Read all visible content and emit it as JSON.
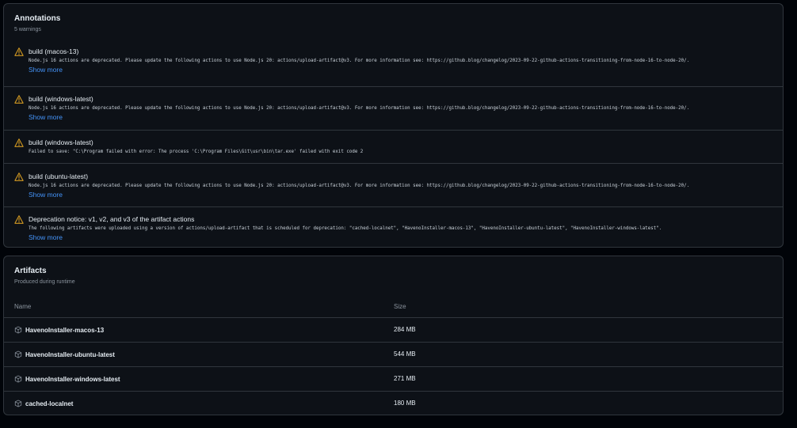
{
  "annotations": {
    "title": "Annotations",
    "subtitle": "5 warnings",
    "items": [
      {
        "title": "build (macos-13)",
        "message": "Node.js 16 actions are deprecated. Please update the following actions to use Node.js 20: actions/upload-artifact@v3. For more information see: https://github.blog/changelog/2023-09-22-github-actions-transitioning-from-node-16-to-node-20/.",
        "more": "Show more"
      },
      {
        "title": "build (windows-latest)",
        "message": "Node.js 16 actions are deprecated. Please update the following actions to use Node.js 20: actions/upload-artifact@v3. For more information see: https://github.blog/changelog/2023-09-22-github-actions-transitioning-from-node-16-to-node-20/.",
        "more": "Show more"
      },
      {
        "title": "build (windows-latest)",
        "message": "Failed to save: \"C:\\Program failed with error: The process 'C:\\Program Files\\Git\\usr\\bin\\tar.exe' failed with exit code 2",
        "more": ""
      },
      {
        "title": "build (ubuntu-latest)",
        "message": "Node.js 16 actions are deprecated. Please update the following actions to use Node.js 20: actions/upload-artifact@v3. For more information see: https://github.blog/changelog/2023-09-22-github-actions-transitioning-from-node-16-to-node-20/.",
        "more": "Show more"
      },
      {
        "title": "Deprecation notice: v1, v2, and v3 of the artifact actions",
        "message": "The following artifacts were uploaded using a version of actions/upload-artifact that is scheduled for deprecation: \"cached-localnet\", \"HavenoInstaller-macos-13\", \"HavenoInstaller-ubuntu-latest\", \"HavenoInstaller-windows-latest\".",
        "more": "Show more"
      }
    ]
  },
  "artifacts": {
    "title": "Artifacts",
    "subtitle": "Produced during runtime",
    "columns": {
      "name": "Name",
      "size": "Size"
    },
    "rows": [
      {
        "name": "HavenoInstaller-macos-13",
        "size": "284 MB"
      },
      {
        "name": "HavenoInstaller-ubuntu-latest",
        "size": "544 MB"
      },
      {
        "name": "HavenoInstaller-windows-latest",
        "size": "271 MB"
      },
      {
        "name": "cached-localnet",
        "size": "180 MB"
      }
    ]
  },
  "colors": {
    "background": "#010409",
    "panel": "#0d1117",
    "border": "#30363d",
    "warning": "#d29922",
    "link": "#4493f8",
    "muted": "#8b949e"
  },
  "icons": {
    "warning": "alert-triangle-icon",
    "artifact": "package-icon"
  }
}
